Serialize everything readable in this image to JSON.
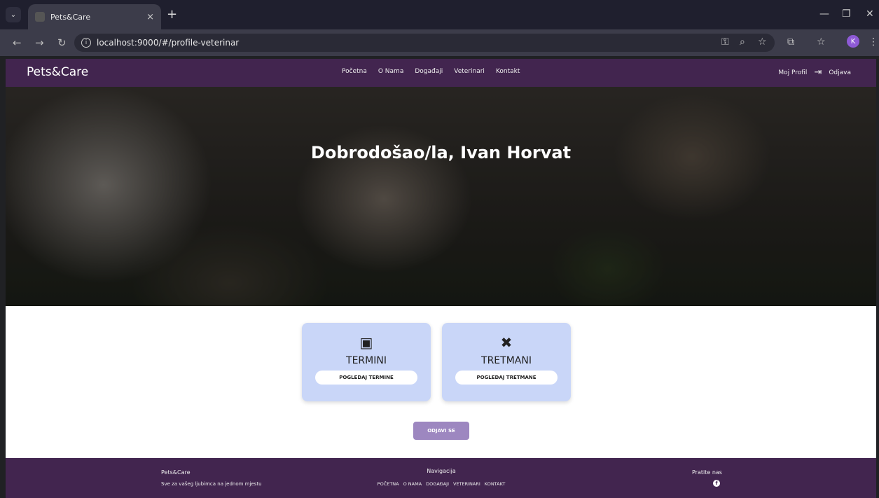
{
  "browser": {
    "tab_title": "Pets&Care",
    "tab_close": "×",
    "new_tab": "+",
    "url": "localhost:9000/#/profile-veterinar",
    "avatar_letter": "K"
  },
  "navbar": {
    "brand": "Pets&Care",
    "links": [
      "Početna",
      "O Nama",
      "Događaji",
      "Veterinari",
      "Kontakt"
    ],
    "profile": "Moj Profil",
    "logout": "Odjava"
  },
  "hero": {
    "title": "Dobrodošao/la, Ivan Horvat"
  },
  "cards": [
    {
      "icon": "calendar-icon",
      "title": "TERMINI",
      "button": "POGLEDAJ TERMINE"
    },
    {
      "icon": "bandage-icon",
      "title": "TRETMANI",
      "button": "POGLEDAJ TRETMANE"
    }
  ],
  "logout_button": "ODJAVI SE",
  "footer": {
    "brand": "Pets&Care",
    "tagline": "Sve za vašeg ljubimca na jednom mjestu",
    "nav_title": "Navigacija",
    "nav_links": [
      "POČETNA",
      "O NAMA",
      "DOGAĐAJI",
      "VETERINARI",
      "KONTAKT"
    ],
    "follow_title": "Pratite nas"
  },
  "colors": {
    "brand_purple": "#42254f",
    "card_blue": "#c9d6f8",
    "logout_button": "#9d87c0"
  }
}
